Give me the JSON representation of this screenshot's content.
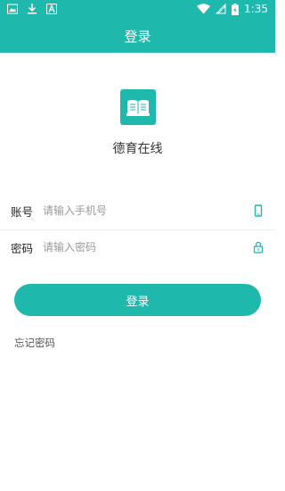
{
  "status_bar": {
    "time": "1:35",
    "icons": [
      "image-icon",
      "download-icon",
      "a-icon",
      "wifi-icon",
      "signal-icon",
      "battery-icon"
    ]
  },
  "header": {
    "title": "登录"
  },
  "app": {
    "name": "德育在线",
    "logo": "book-icon"
  },
  "form": {
    "account": {
      "label": "账号",
      "placeholder": "请输入手机号",
      "icon": "phone-icon"
    },
    "password": {
      "label": "密码",
      "placeholder": "请输入密码",
      "icon": "lock-icon"
    },
    "submit_label": "登录",
    "forgot_label": "忘记密码"
  },
  "colors": {
    "accent": "#1fb8ad"
  }
}
